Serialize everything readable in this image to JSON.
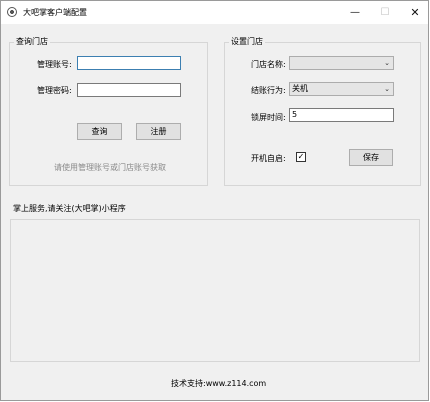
{
  "window": {
    "title": "大吧掌客户端配置",
    "minimize_glyph": "—",
    "maximize_glyph": "☐",
    "close_glyph": "✕"
  },
  "query_store": {
    "group_title": "查询门店",
    "account_label": "管理账号:",
    "account_value": "",
    "password_label": "管理密码:",
    "password_value": "",
    "query_button": "查询",
    "register_button": "注册",
    "hint": "请使用管理账号或门店账号获取"
  },
  "set_store": {
    "group_title": "设置门店",
    "store_name_label": "门店名称:",
    "store_name_value": "",
    "checkout_label": "结账行为:",
    "checkout_value": "关机",
    "lock_label": "锁屏时间:",
    "lock_value": "5",
    "autostart_label": "开机自启:",
    "autostart_checked": true,
    "check_glyph": "✓",
    "save_button": "保存"
  },
  "panel": {
    "title": "掌上服务,请关注(大吧掌)小程序"
  },
  "footer": {
    "text": "技术支持:www.z114.com"
  }
}
